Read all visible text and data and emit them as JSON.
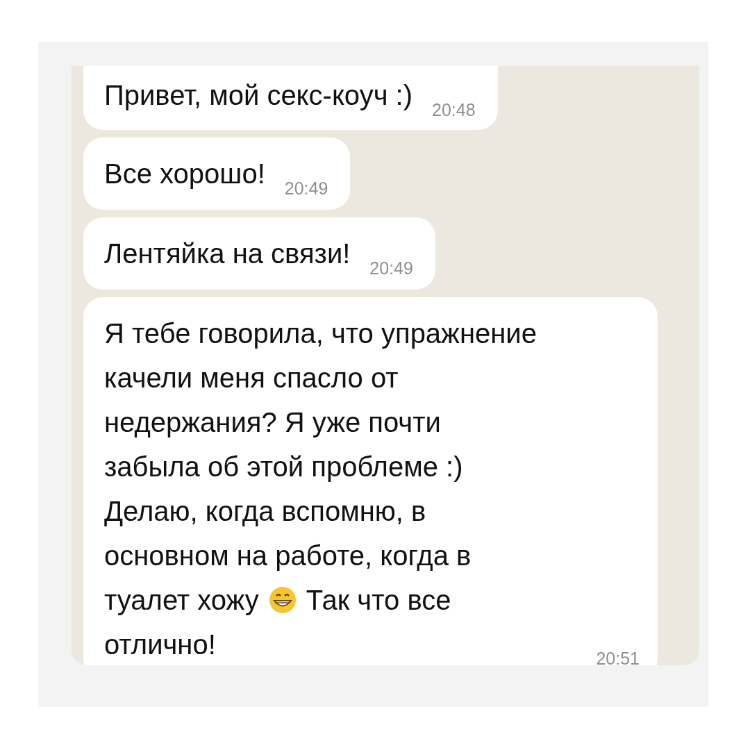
{
  "messages": [
    {
      "lines": [
        [
          {
            "kind": "text",
            "text": "Привет, мой секс-коуч :)"
          }
        ]
      ],
      "time": "20:48"
    },
    {
      "lines": [
        [
          {
            "kind": "text",
            "text": "Все хорошо!"
          }
        ]
      ],
      "time": "20:49"
    },
    {
      "lines": [
        [
          {
            "kind": "text",
            "text": "Лентяйка на связи!"
          }
        ]
      ],
      "time": "20:49"
    },
    {
      "lines": [
        [
          {
            "kind": "text",
            "text": "Я тебе говорила, что упражнение"
          }
        ],
        [
          {
            "kind": "text",
            "text": "качели меня спасло от"
          }
        ],
        [
          {
            "kind": "text",
            "text": "недержания? Я уже почти"
          }
        ],
        [
          {
            "kind": "text",
            "text": "забыла об этой проблеме :)"
          }
        ],
        [
          {
            "kind": "text",
            "text": "Делаю, когда вспомню, в"
          }
        ],
        [
          {
            "kind": "text",
            "text": "основном на работе, когда в"
          }
        ],
        [
          {
            "kind": "text",
            "text": "туалет хожу"
          },
          {
            "kind": "emoji"
          },
          {
            "kind": "text",
            "text": "Так что все"
          }
        ],
        [
          {
            "kind": "text",
            "text": "отлично!"
          }
        ]
      ],
      "time": "20:51"
    }
  ]
}
